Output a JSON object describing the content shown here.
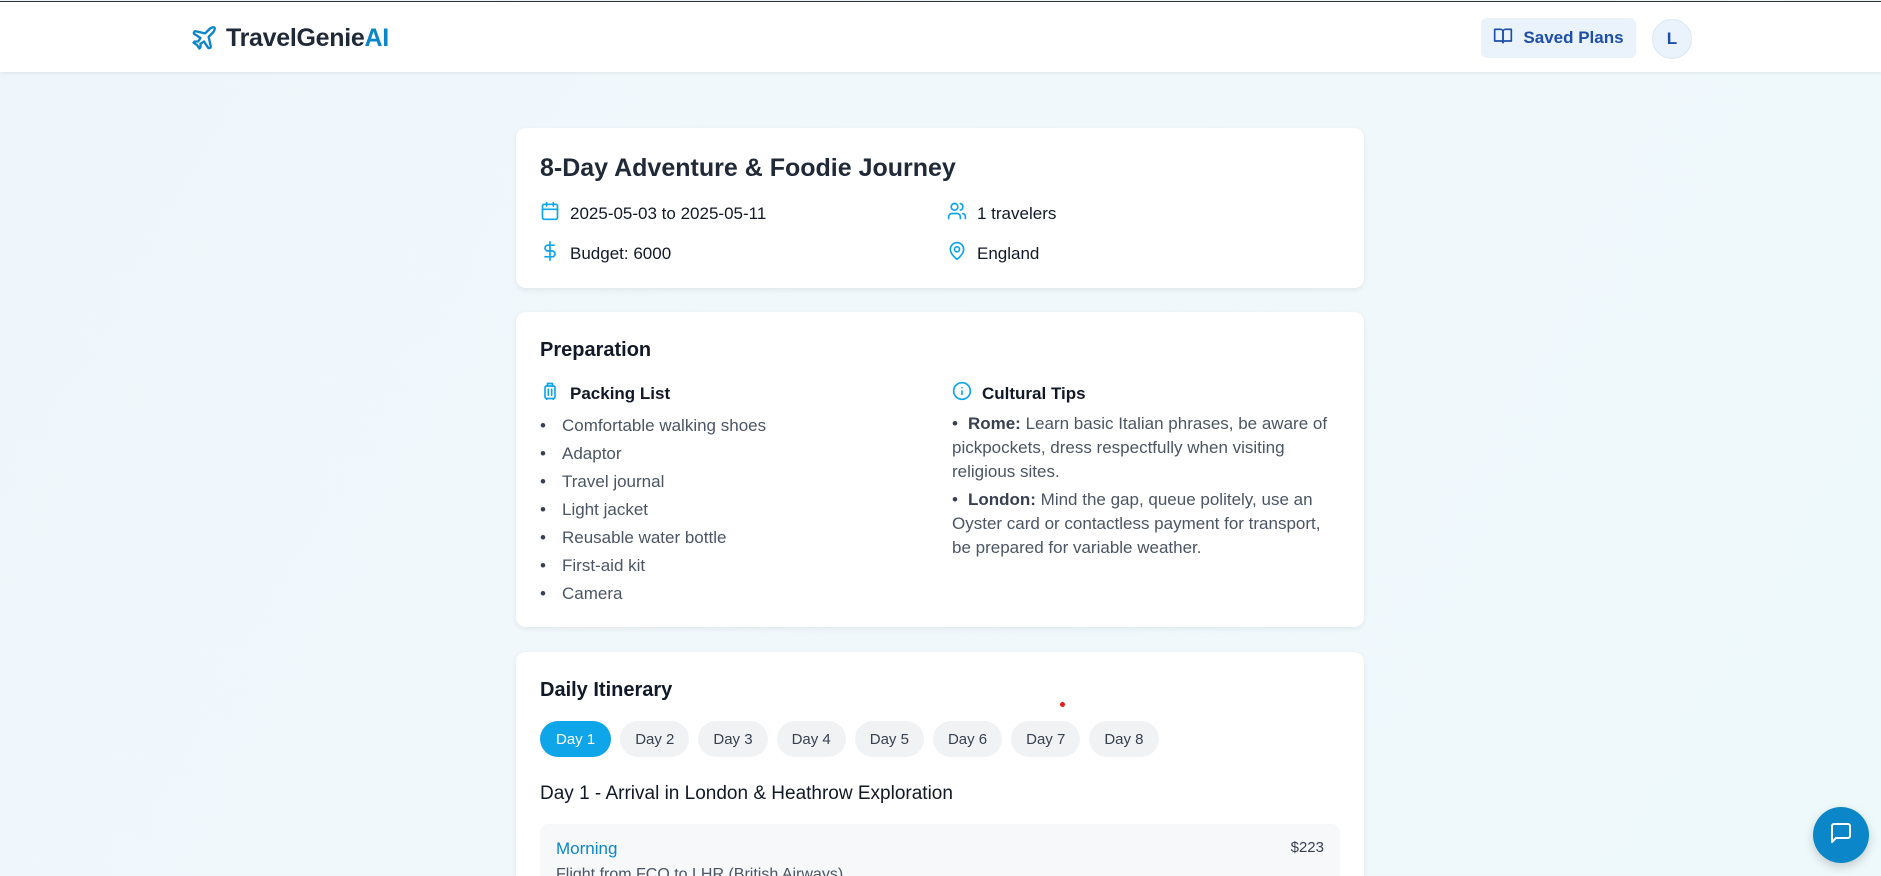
{
  "header": {
    "brand_main": "TravelGenie",
    "brand_suffix": "AI",
    "saved_plans_label": "Saved Plans",
    "avatar_initial": "L"
  },
  "summary": {
    "title": "8-Day Adventure & Foodie Journey",
    "dates": "2025-05-03 to 2025-05-11",
    "travelers": "1 travelers",
    "budget": "Budget: 6000",
    "location": "England"
  },
  "preparation": {
    "title": "Preparation",
    "packing_title": "Packing List",
    "packing_items": [
      "Comfortable walking shoes",
      "Adaptor",
      "Travel journal",
      "Light jacket",
      "Reusable water bottle",
      "First-aid kit",
      "Camera"
    ],
    "tips_title": "Cultural Tips",
    "tips": [
      {
        "city": "Rome:",
        "text": "Learn basic Italian phrases, be aware of pickpockets, dress respectfully when visiting religious sites."
      },
      {
        "city": "London:",
        "text": "Mind the gap, queue politely, use an Oyster card or contactless payment for transport, be prepared for variable weather."
      }
    ]
  },
  "itinerary": {
    "title": "Daily Itinerary",
    "days": [
      "Day 1",
      "Day 2",
      "Day 3",
      "Day 4",
      "Day 5",
      "Day 6",
      "Day 7",
      "Day 8"
    ],
    "active_day": "Day 1",
    "day_heading": "Day 1 - Arrival in London & Heathrow Exploration",
    "slot": {
      "time": "Morning",
      "cost": "$223",
      "description": "Flight from FCO to LHR (British Airways)"
    }
  },
  "icons": {
    "brand": "plane-icon",
    "saved": "book-open-icon",
    "dates": "calendar-icon",
    "travelers": "users-icon",
    "budget": "dollar-icon",
    "location": "map-pin-icon",
    "packing": "luggage-icon",
    "tips": "info-icon",
    "chat": "chat-icon"
  },
  "colors": {
    "accent": "#0b86c8",
    "active_tab": "#0ea5e9",
    "saved_button_bg": "#eaf3fb"
  }
}
